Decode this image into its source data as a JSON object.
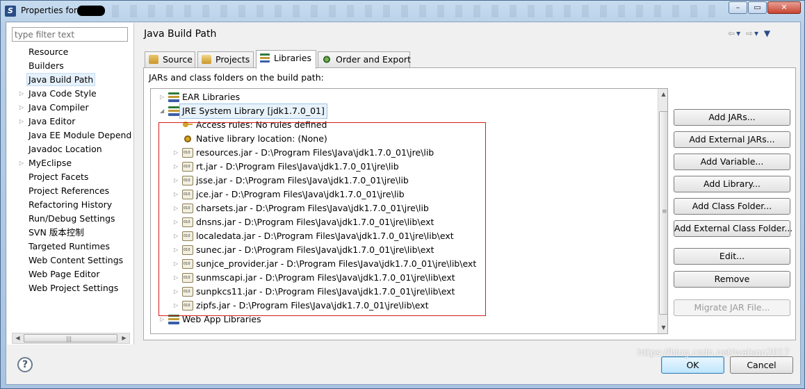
{
  "window": {
    "title": "Properties for",
    "controls": {
      "minimize": "–",
      "maximize": "▭",
      "close": "✕"
    }
  },
  "sidebar": {
    "filter_placeholder": "type filter text",
    "items": [
      {
        "label": "Resource",
        "expandable": false
      },
      {
        "label": "Builders",
        "expandable": false
      },
      {
        "label": "Java Build Path",
        "expandable": false,
        "selected": true
      },
      {
        "label": "Java Code Style",
        "expandable": true
      },
      {
        "label": "Java Compiler",
        "expandable": true
      },
      {
        "label": "Java Editor",
        "expandable": true
      },
      {
        "label": "Java EE Module Depend",
        "expandable": false
      },
      {
        "label": "Javadoc Location",
        "expandable": false
      },
      {
        "label": "MyEclipse",
        "expandable": true
      },
      {
        "label": "Project Facets",
        "expandable": false
      },
      {
        "label": "Project References",
        "expandable": false
      },
      {
        "label": "Refactoring History",
        "expandable": false
      },
      {
        "label": "Run/Debug Settings",
        "expandable": false
      },
      {
        "label": "SVN 版本控制",
        "expandable": false
      },
      {
        "label": "Targeted Runtimes",
        "expandable": false
      },
      {
        "label": "Web Content Settings",
        "expandable": false
      },
      {
        "label": "Web Page Editor",
        "expandable": false
      },
      {
        "label": "Web Project Settings",
        "expandable": false
      }
    ]
  },
  "main": {
    "title": "Java Build Path",
    "tabs": [
      {
        "label": "Source",
        "active": false
      },
      {
        "label": "Projects",
        "active": false
      },
      {
        "label": "Libraries",
        "active": true
      },
      {
        "label": "Order and Export",
        "active": false
      }
    ],
    "list_label": "JARs and class folders on the build path:",
    "tree": [
      {
        "text": "EAR Libraries",
        "icon": "library-icon",
        "level": 0,
        "expander": "collapsed"
      },
      {
        "text": "JRE System Library [jdk1.7.0_01]",
        "icon": "library-icon",
        "level": 0,
        "expander": "expanded",
        "selected": true
      },
      {
        "text": "Access rules: No rules defined",
        "icon": "key-icon",
        "level": 1,
        "expander": "none"
      },
      {
        "text": "Native library location: (None)",
        "icon": "gear-icon",
        "level": 1,
        "expander": "none"
      },
      {
        "text": "resources.jar - D:\\Program Files\\Java\\jdk1.7.0_01\\jre\\lib",
        "icon": "jar-icon",
        "level": 1,
        "expander": "collapsed"
      },
      {
        "text": "rt.jar - D:\\Program Files\\Java\\jdk1.7.0_01\\jre\\lib",
        "icon": "jar-icon",
        "level": 1,
        "expander": "collapsed"
      },
      {
        "text": "jsse.jar - D:\\Program Files\\Java\\jdk1.7.0_01\\jre\\lib",
        "icon": "jar-icon",
        "level": 1,
        "expander": "collapsed"
      },
      {
        "text": "jce.jar - D:\\Program Files\\Java\\jdk1.7.0_01\\jre\\lib",
        "icon": "jar-icon",
        "level": 1,
        "expander": "collapsed"
      },
      {
        "text": "charsets.jar - D:\\Program Files\\Java\\jdk1.7.0_01\\jre\\lib",
        "icon": "jar-icon",
        "level": 1,
        "expander": "collapsed"
      },
      {
        "text": "dnsns.jar - D:\\Program Files\\Java\\jdk1.7.0_01\\jre\\lib\\ext",
        "icon": "jar-icon",
        "level": 1,
        "expander": "collapsed"
      },
      {
        "text": "localedata.jar - D:\\Program Files\\Java\\jdk1.7.0_01\\jre\\lib\\ext",
        "icon": "jar-icon",
        "level": 1,
        "expander": "collapsed"
      },
      {
        "text": "sunec.jar - D:\\Program Files\\Java\\jdk1.7.0_01\\jre\\lib\\ext",
        "icon": "jar-icon",
        "level": 1,
        "expander": "collapsed"
      },
      {
        "text": "sunjce_provider.jar - D:\\Program Files\\Java\\jdk1.7.0_01\\jre\\lib\\ext",
        "icon": "jar-icon",
        "level": 1,
        "expander": "collapsed"
      },
      {
        "text": "sunmscapi.jar - D:\\Program Files\\Java\\jdk1.7.0_01\\jre\\lib\\ext",
        "icon": "jar-icon",
        "level": 1,
        "expander": "collapsed"
      },
      {
        "text": "sunpkcs11.jar - D:\\Program Files\\Java\\jdk1.7.0_01\\jre\\lib\\ext",
        "icon": "jar-icon",
        "level": 1,
        "expander": "collapsed"
      },
      {
        "text": "zipfs.jar - D:\\Program Files\\Java\\jdk1.7.0_01\\jre\\lib\\ext",
        "icon": "jar-icon",
        "level": 1,
        "expander": "collapsed"
      },
      {
        "text": "Web App Libraries",
        "icon": "library-icon",
        "level": 0,
        "expander": "collapsed"
      }
    ],
    "buttons": [
      {
        "label": "Add JARs...",
        "enabled": true
      },
      {
        "label": "Add External JARs...",
        "enabled": true
      },
      {
        "label": "Add Variable...",
        "enabled": true
      },
      {
        "label": "Add Library...",
        "enabled": true
      },
      {
        "label": "Add Class Folder...",
        "enabled": true
      },
      {
        "label": "Add External Class Folder...",
        "enabled": true
      },
      {
        "label": "Edit...",
        "enabled": true
      },
      {
        "label": "Remove",
        "enabled": true
      },
      {
        "label": "Migrate JAR File...",
        "enabled": false
      }
    ]
  },
  "footer": {
    "help": "?",
    "ok_label": "OK",
    "cancel_label": "Cancel",
    "watermark": "https://blog.csdn.net/watson2017"
  },
  "colors": {
    "highlight_box": "#d21c1c",
    "selection": "#e5f1fb",
    "ok_button": "#bee6fd"
  }
}
